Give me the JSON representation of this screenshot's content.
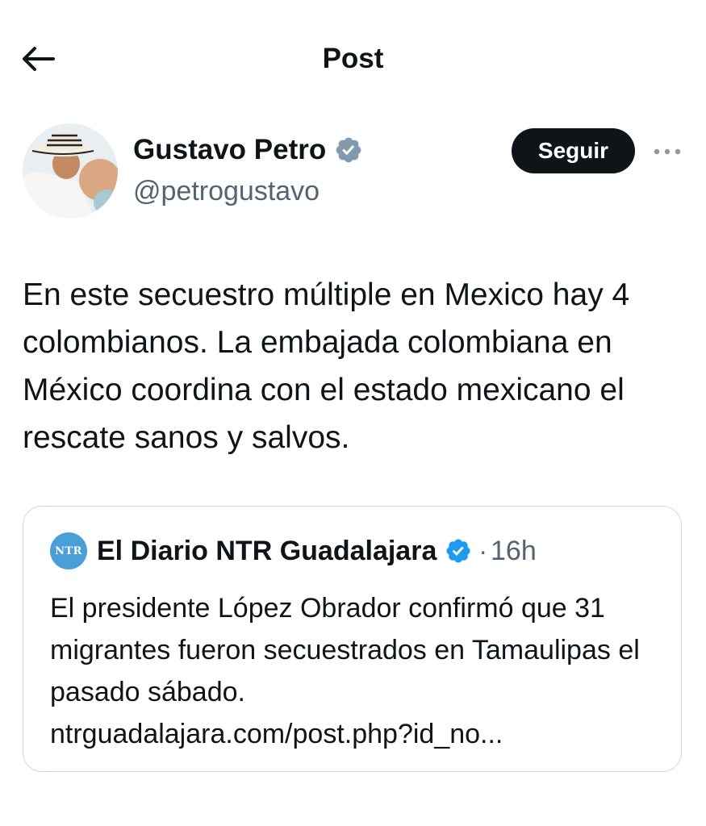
{
  "header": {
    "title": "Post",
    "back_icon": "arrow-left-icon"
  },
  "post": {
    "author": {
      "name": "Gustavo Petro",
      "handle": "@petrogustavo",
      "verified": true
    },
    "follow_label": "Seguir",
    "more_icon": "more-horizontal-icon",
    "text": "En este secuestro múltiple en Mexico hay 4 colombianos. La embajada colombiana en México coordina con el estado mexicano el rescate sanos y salvos."
  },
  "quote": {
    "avatar_text": "NTR",
    "author_name": "El Diario NTR Guadalajara",
    "verified": true,
    "separator": "·",
    "time": "16h",
    "text": "El presidente López Obrador confirmó que 31 migrantes fueron secuestrados en Tamaulipas el pasado sábado.",
    "link": "ntrguadalajara.com/post.php?id_no..."
  },
  "colors": {
    "text": "#0f1419",
    "muted": "#536471",
    "verified_blue": "#1d9bf0",
    "verified_gray": "#829aab",
    "border": "#cfd9de",
    "button_bg": "#0f1419"
  }
}
